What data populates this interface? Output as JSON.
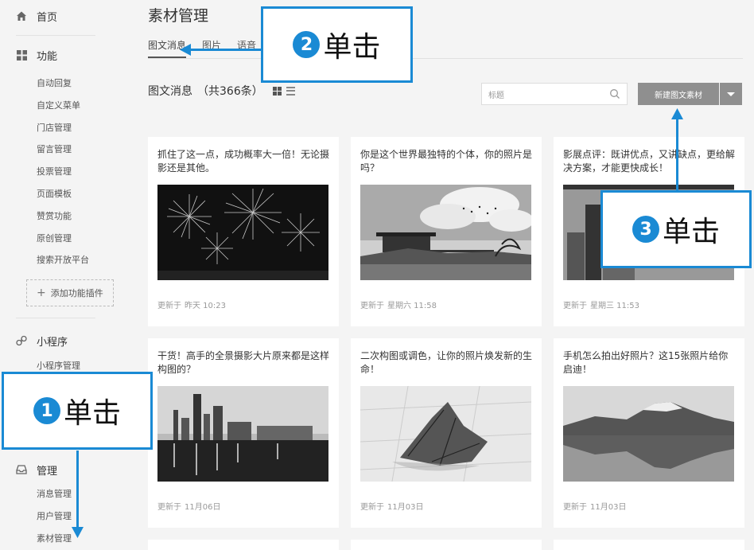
{
  "sidebar": {
    "home": "首页",
    "features": {
      "label": "功能",
      "items": [
        "自动回复",
        "自定义菜单",
        "门店管理",
        "留言管理",
        "投票管理",
        "页面模板",
        "赞赏功能",
        "原创管理",
        "搜索开放平台"
      ],
      "add_plugin": "添加功能插件"
    },
    "miniprogram": {
      "label": "小程序",
      "items": [
        "小程序管理"
      ]
    },
    "manage": {
      "label": "管理",
      "items": [
        "消息管理",
        "用户管理",
        "素材管理"
      ]
    }
  },
  "main": {
    "title": "素材管理",
    "tabs": [
      {
        "label": "图文消息",
        "active": true
      },
      {
        "label": "图片"
      },
      {
        "label": "语音"
      }
    ],
    "list_title": "图文消息",
    "count": "（共366条）",
    "search_placeholder": "标题",
    "new_button": "新建图文素材",
    "cards": [
      {
        "title": "抓住了这一点，成功概率大一倍！无论摄影还是其他。",
        "time_label": "更新于",
        "time": "昨天 10:23",
        "image": "fireworks"
      },
      {
        "title": "你是这个世界最独特的个体，你的照片是吗？",
        "time_label": "更新于",
        "time": "星期六 11:58",
        "image": "lake-house"
      },
      {
        "title": "影展点评：既讲优点，又讲缺点，更给解决方案，才能更快成长！",
        "time_label": "更新于",
        "time": "星期三 11:53",
        "image": "city-tower"
      },
      {
        "title": "干货！高手的全景摄影大片原来都是这样构图的？",
        "time_label": "更新于",
        "time": "11月06日",
        "image": "city-skyline"
      },
      {
        "title": "二次构图或调色，让你的照片焕发新的生命！",
        "time_label": "更新于",
        "time": "11月03日",
        "image": "leaf"
      },
      {
        "title": "手机怎么拍出好照片？这15张照片给你启迪！",
        "time_label": "更新于",
        "time": "11月03日",
        "image": "mountain"
      }
    ]
  },
  "callouts": [
    {
      "num": "1",
      "text": "单击"
    },
    {
      "num": "2",
      "text": "单击"
    },
    {
      "num": "3",
      "text": "单击"
    }
  ],
  "colors": {
    "callout_blue": "#1a8ad4",
    "button_gray": "#8f8f8f"
  }
}
